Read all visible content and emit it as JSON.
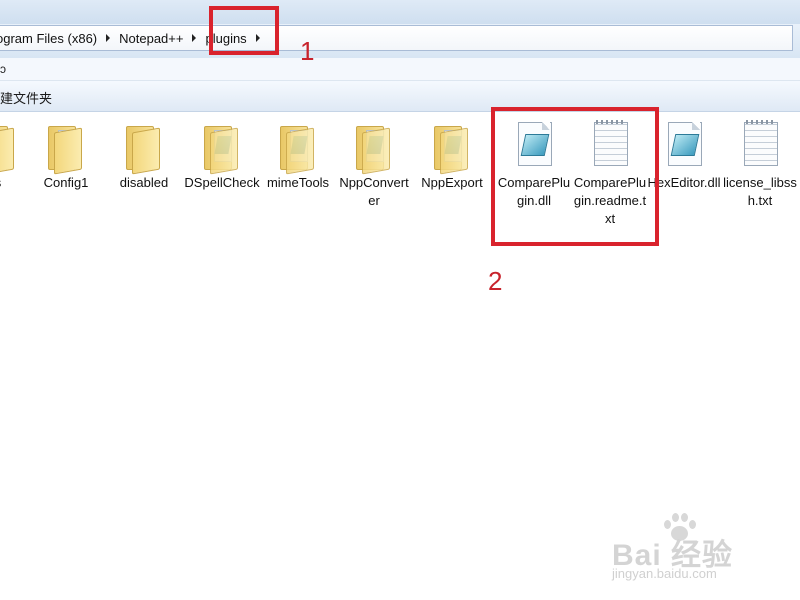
{
  "breadcrumb": {
    "items": [
      "ogram Files (x86)",
      "Notepad++",
      "plugins"
    ]
  },
  "strip": {
    "glyph": "ɔ"
  },
  "toolbar": {
    "new_folder_label": "建文件夹"
  },
  "files": [
    {
      "name": "s",
      "type": "folder-cut"
    },
    {
      "name": "Config1",
      "type": "folder"
    },
    {
      "name": "disabled",
      "type": "folder"
    },
    {
      "name": "DSpellCheck",
      "type": "folder-doc"
    },
    {
      "name": "mimeTools",
      "type": "folder-doc"
    },
    {
      "name": "NppConverter",
      "type": "folder-doc"
    },
    {
      "name": "NppExport",
      "type": "folder-doc"
    },
    {
      "name": "ComparePlugin.dll",
      "type": "dll"
    },
    {
      "name": "ComparePlugin.readme.txt",
      "type": "txt"
    },
    {
      "name": "HexEditor.dll",
      "type": "dll"
    },
    {
      "name": "license_libssh.txt",
      "type": "txt"
    }
  ],
  "annotations": {
    "label1": "1",
    "label2": "2",
    "color": "#d9232d"
  },
  "watermark": {
    "brand": "Bai 经验",
    "du": "du",
    "url": "jingyan.baidu.com"
  }
}
